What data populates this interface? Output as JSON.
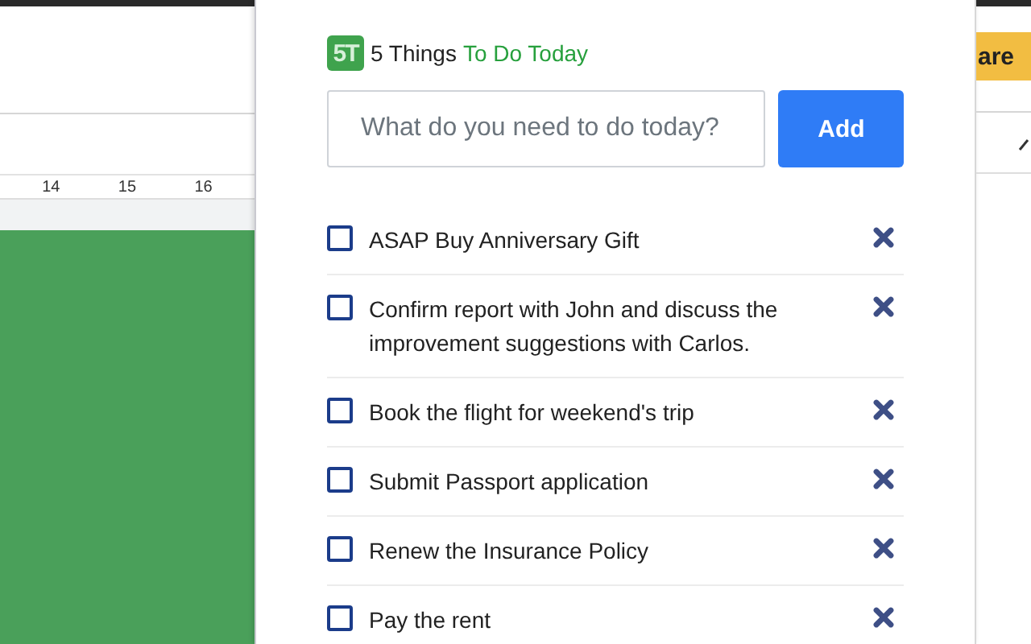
{
  "background": {
    "ruler_numbers": [
      "14",
      "15",
      "16"
    ],
    "share_button": "are"
  },
  "popup": {
    "logo": "5T",
    "title": "5 Things",
    "title_accent": "To Do Today",
    "input": {
      "placeholder": "What do you need to do today?"
    },
    "add_button": "Add",
    "tasks": [
      {
        "text": "ASAP Buy Anniversary Gift",
        "checked": false
      },
      {
        "text": "Confirm report with John and discuss the improvement suggestions with Carlos.",
        "checked": false
      },
      {
        "text": "Book the flight for weekend's trip",
        "checked": false
      },
      {
        "text": "Submit Passport application",
        "checked": false
      },
      {
        "text": "Renew the Insurance Policy",
        "checked": false
      },
      {
        "text": "Pay the rent",
        "checked": false
      }
    ]
  }
}
